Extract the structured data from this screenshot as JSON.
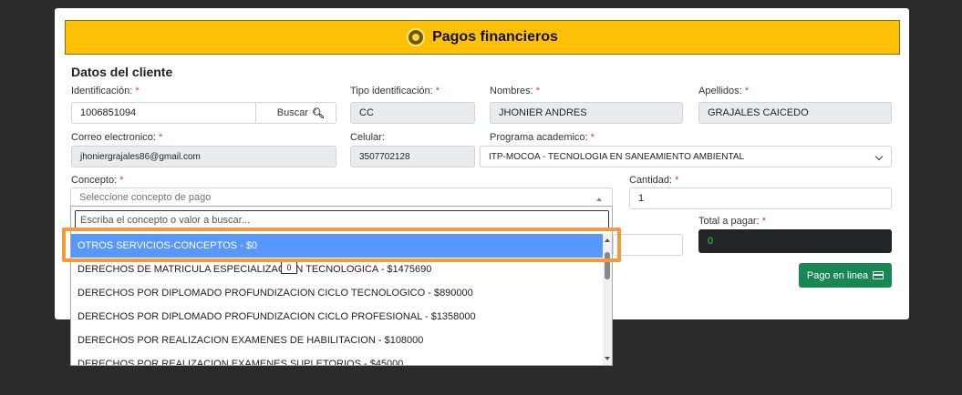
{
  "header": {
    "title": "Pagos financieros"
  },
  "section": {
    "title": "Datos del cliente"
  },
  "fields": {
    "identificacion": {
      "label": "Identificación:",
      "value": "1006851094"
    },
    "buscar_label": "Buscar",
    "tipo_identificacion": {
      "label": "Tipo identificación:",
      "value": "CC"
    },
    "nombres": {
      "label": "Nombres:",
      "value": "JHONIER ANDRES"
    },
    "apellidos": {
      "label": "Apellidos:",
      "value": "GRAJALES CAICEDO"
    },
    "correo": {
      "label": "Correo electronico:",
      "value": "jhoniergrajales86@gmail.com"
    },
    "celular": {
      "label": "Celular:",
      "value": "3507702128"
    },
    "programa": {
      "label": "Programa academico:",
      "value": "ITP-MOCOA - TECNOLOGIA EN SANEAMIENTO AMBIENTAL"
    },
    "concepto": {
      "label": "Concepto:",
      "placeholder": "Seleccione concepto de pago"
    },
    "cantidad": {
      "label": "Cantidad:",
      "value": "1"
    },
    "total": {
      "label": "Total a pagar:",
      "value": "0"
    }
  },
  "required_mark": "*",
  "dropdown": {
    "search_placeholder": "Escriba el concepto o valor a buscar...",
    "items": [
      "OTROS SERVICIOS-CONCEPTOS - $0",
      "DERECHOS DE MATRICULA ESPECIALIZACION TECNOLOGICA - $1475690",
      "DERECHOS POR DIPLOMADO PROFUNDIZACION CICLO TECNOLOGICO - $890000",
      "DERECHOS POR DIPLOMADO PROFUNDIZACION CICLO PROFESIONAL - $1358000",
      "DERECHOS POR REALIZACION EXAMENES DE HABILITACION - $108000",
      "DERECHOS POR REALIZACION EXAMENES SUPLETORIOS - $45000"
    ],
    "selected_index": 0,
    "tooltip": "0"
  },
  "pay_button": {
    "label": "Pago en linea"
  },
  "colors": {
    "header": "#ffc107",
    "selected": "#5897fb",
    "pay": "#198754",
    "highlight": "#f59a3c"
  }
}
